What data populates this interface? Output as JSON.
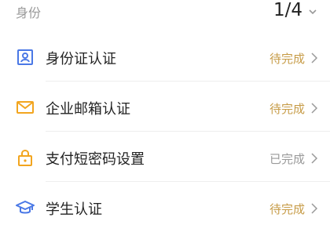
{
  "header": {
    "section_title": "身份",
    "progress": "1/4"
  },
  "colors": {
    "pending": "#c79c48",
    "done": "#999999",
    "blue": "#4a78e6",
    "orange": "#f2a51f"
  },
  "items": [
    {
      "label": "身份证认证",
      "status": "待完成",
      "icon": "id-card-icon"
    },
    {
      "label": "企业邮箱认证",
      "status": "待完成",
      "icon": "mail-icon"
    },
    {
      "label": "支付短密码设置",
      "status": "已完成",
      "icon": "lock-icon"
    },
    {
      "label": "学生认证",
      "status": "待完成",
      "icon": "graduation-cap-icon"
    }
  ]
}
